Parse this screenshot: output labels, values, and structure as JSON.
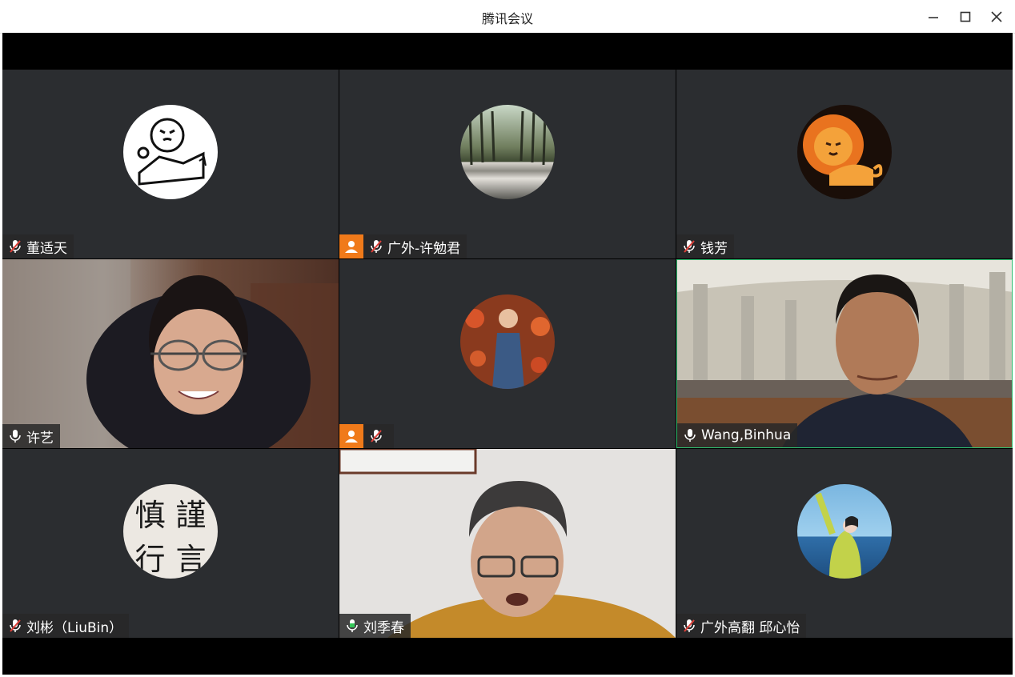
{
  "window": {
    "title": "腾讯会议"
  },
  "participants": [
    {
      "name": "董适天",
      "mic": "muted"
    },
    {
      "name": "广外-许勉君",
      "mic": "muted",
      "badge": "host-person-icon"
    },
    {
      "name": "钱芳",
      "mic": "muted"
    },
    {
      "name": "许艺",
      "mic": "on"
    },
    {
      "name": "",
      "mic": "muted",
      "badge": "host-person-icon"
    },
    {
      "name": "Wang,Binhua",
      "mic": "on",
      "speaking": true
    },
    {
      "name": "刘彬（LiuBin）",
      "mic": "muted"
    },
    {
      "name": "刘季春",
      "mic": "speaking"
    },
    {
      "name": "广外高翻 邱心怡",
      "mic": "muted"
    }
  ],
  "avatar_texts": {
    "calligraphy": [
      "慎",
      "謹",
      "行",
      "言"
    ]
  },
  "colors": {
    "tile_bg": "#2b2d30",
    "badge": "#f07a1a",
    "active_border": "#2fbf71",
    "muted_red": "#e0413a",
    "speaking_green": "#34c759"
  }
}
